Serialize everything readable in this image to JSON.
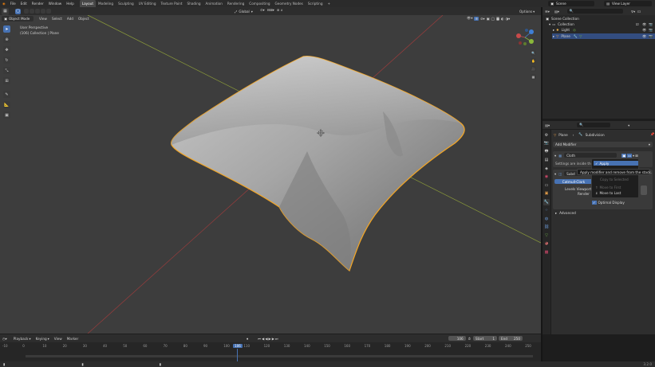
{
  "topbar": {
    "menus": [
      "File",
      "Edit",
      "Render",
      "Window",
      "Help"
    ],
    "workspaces": [
      "Layout",
      "Modeling",
      "Sculpting",
      "UV Editing",
      "Texture Paint",
      "Shading",
      "Animation",
      "Rendering",
      "Compositing",
      "Geometry Nodes",
      "Scripting"
    ],
    "active_workspace": "Layout",
    "add_tab": "+",
    "scene": "Scene",
    "view_layer": "View Layer"
  },
  "viewport_header": {
    "mode": "Object Mode",
    "menus": [
      "View",
      "Select",
      "Add",
      "Object"
    ],
    "transform": "Global",
    "options": "Options"
  },
  "viewport": {
    "perspective": "User Perspective",
    "collection_info": "(106) Collection | Plane",
    "axes": [
      "X",
      "Y",
      "Z"
    ]
  },
  "outliner": {
    "root": "Scene Collection",
    "items": [
      {
        "label": "Collection"
      },
      {
        "label": "Light"
      },
      {
        "label": "Plane"
      }
    ]
  },
  "properties": {
    "object_name": "Plane",
    "modifier_name": "Subdivision",
    "add_modifier": "Add Modifier",
    "cloth_name": "Cloth",
    "settings_note": "Settings are inside the P",
    "catmull": "Catmull-Clark",
    "levels_viewport": "Levels Viewport",
    "render": "Render",
    "optimal_display": "Optimal Display",
    "advanced": "Advanced",
    "subd_short": "Subd"
  },
  "context_menu": {
    "items": [
      {
        "label": "Apply",
        "highlight": true
      },
      {
        "label": "Copy to Selected",
        "highlight": false
      },
      {
        "label": "Move to First",
        "highlight": false
      },
      {
        "label": "Move to Last",
        "highlight": false
      }
    ],
    "tooltip": "Apply modifier and remove from the stack."
  },
  "timeline": {
    "menus": [
      "Playback",
      "Keying",
      "View",
      "Marker"
    ],
    "current_frame": "106",
    "start_label": "Start",
    "start_value": "1",
    "end_label": "End",
    "end_value": "250",
    "ticks": [
      "-10",
      "0",
      "10",
      "20",
      "30",
      "40",
      "50",
      "60",
      "70",
      "80",
      "90",
      "100",
      "110",
      "120",
      "130",
      "140",
      "150",
      "160",
      "170",
      "180",
      "190",
      "200",
      "210",
      "220",
      "230",
      "240",
      "250"
    ],
    "playhead_label": "106"
  },
  "status": {
    "version": "3.2.0"
  },
  "colors": {
    "accent": "#4772b3",
    "selection_outline": "#f5a623",
    "x_axis": "#c84a4a",
    "y_axis": "#8ab83a",
    "z_axis": "#3f7fd6"
  }
}
